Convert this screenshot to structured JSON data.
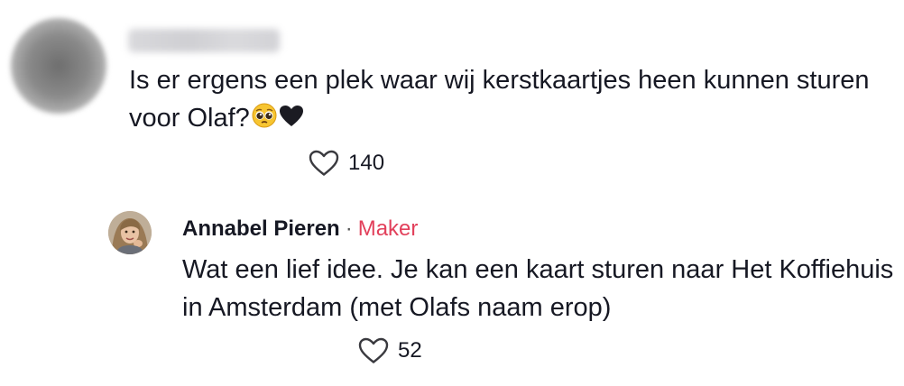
{
  "comment": {
    "text": "Is er ergens een plek waar wij kerstkaartjes heen kunnen sturen voor Olaf?",
    "emojis": [
      "pleading-face-icon",
      "black-heart-icon"
    ],
    "likes": "140"
  },
  "reply": {
    "author": "Annabel Pieren",
    "separator": "·",
    "badge": "Maker",
    "text": "Wat een lief idee. Je kan een kaart sturen naar Het Koffiehuis in Amsterdam (met Olafs naam erop)",
    "likes": "52"
  },
  "colors": {
    "text": "#161823",
    "badge": "#e2405b",
    "icon_stroke": "#3a3a3f"
  }
}
